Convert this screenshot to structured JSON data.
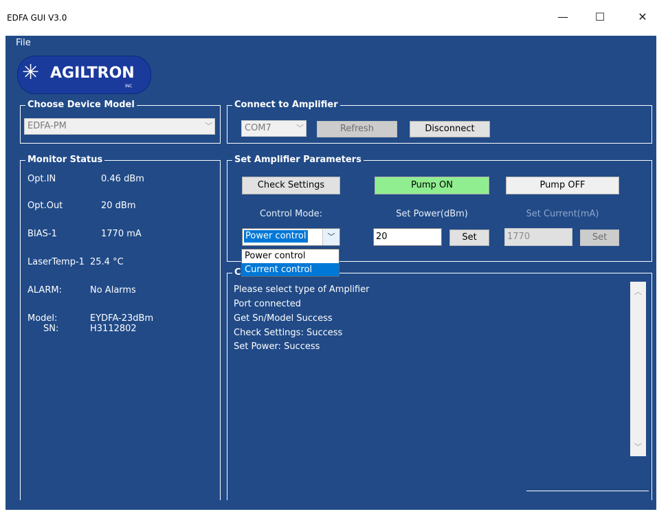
{
  "window": {
    "title": "EDFA GUI V3.0",
    "minimize": "—",
    "maximize": "☐",
    "close": "✕"
  },
  "menu": {
    "file": "File"
  },
  "logo": {
    "text": "AGILTRON",
    "inc": "INC"
  },
  "device_model": {
    "title": "Choose Device Model",
    "selected": "EDFA-PM"
  },
  "connect": {
    "title": "Connect to Amplifier",
    "port": "COM7",
    "refresh": "Refresh",
    "disconnect": "Disconnect"
  },
  "monitor": {
    "title": "Monitor Status",
    "opt_in_label": "Opt.IN",
    "opt_in_value": "0.46 dBm",
    "opt_out_label": "Opt.Out",
    "opt_out_value": "20 dBm",
    "bias_label": "BIAS-1",
    "bias_value": "1770 mA",
    "temp_label": "LaserTemp-1",
    "temp_value": "25.4 °C",
    "alarm_label": "ALARM:",
    "alarm_value": "No Alarms",
    "model_label": "Model:",
    "model_value": "EYDFA-23dBm",
    "sn_label": "SN:",
    "sn_value": "H3112802"
  },
  "params": {
    "title": "Set Amplifier Parameters",
    "check_settings": "Check Settings",
    "pump_on": "Pump ON",
    "pump_off": "Pump OFF",
    "control_mode_label": "Control Mode:",
    "set_power_label": "Set Power(dBm)",
    "set_current_label": "Set Current(mA)",
    "control_mode_value": "Power control",
    "power_value": "20",
    "current_value": "1770",
    "set": "Set",
    "options": [
      "Power control",
      "Current control"
    ]
  },
  "console": {
    "title_visible": "C",
    "lines": [
      "Please select type of Amplifier",
      "Port connected",
      "Get Sn/Model Success",
      "Check Settings: Success",
      "Set Power: Success"
    ]
  },
  "colors": {
    "background": "#214a87",
    "pump_on": "#90ee90",
    "selection": "#0078d7"
  }
}
